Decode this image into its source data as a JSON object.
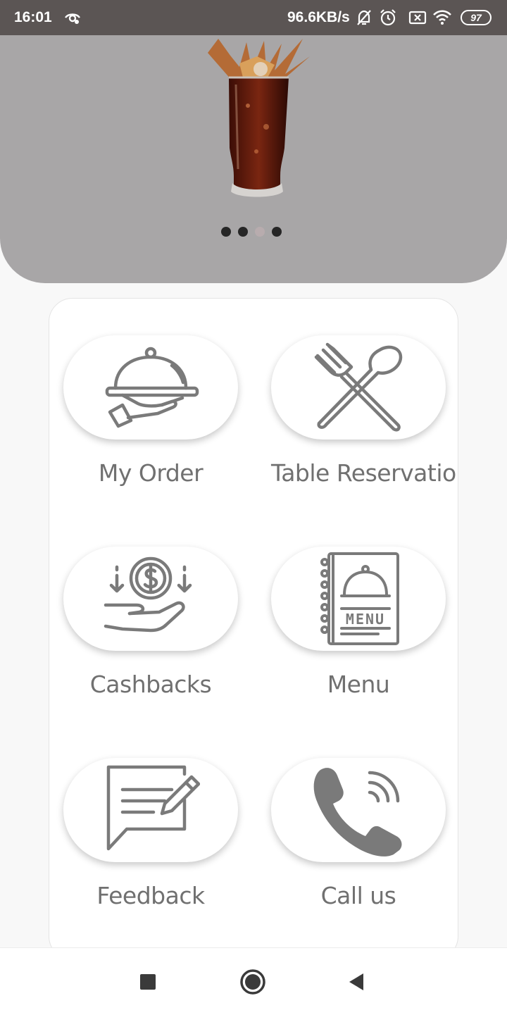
{
  "status_bar": {
    "time": "16:01",
    "network_speed": "96.6KB/s",
    "battery": "97",
    "icons": [
      "eye-icon",
      "mute-icon",
      "alarm-icon",
      "sim-icon",
      "wifi-icon",
      "battery-icon"
    ]
  },
  "hero": {
    "image": "cola-glass-splash",
    "carousel_active_index": 2,
    "carousel_count": 4
  },
  "menu_tiles": [
    {
      "label": "My Order",
      "icon": "serving-cloche-icon"
    },
    {
      "label": "Table Reservatio",
      "icon": "fork-spoon-icon"
    },
    {
      "label": "Cashbacks",
      "icon": "cashback-icon"
    },
    {
      "label": "Menu",
      "icon": "menu-book-icon"
    },
    {
      "label": "Feedback",
      "icon": "feedback-icon"
    },
    {
      "label": "Call us",
      "icon": "phone-icon"
    }
  ],
  "nav": {
    "buttons": [
      "recents-icon",
      "home-icon",
      "back-icon"
    ]
  },
  "colors": {
    "status_bar": "#5b5554",
    "hero_background": "#a8a6a7",
    "icon_gray": "#7a7a7a",
    "label_gray": "#707070"
  }
}
